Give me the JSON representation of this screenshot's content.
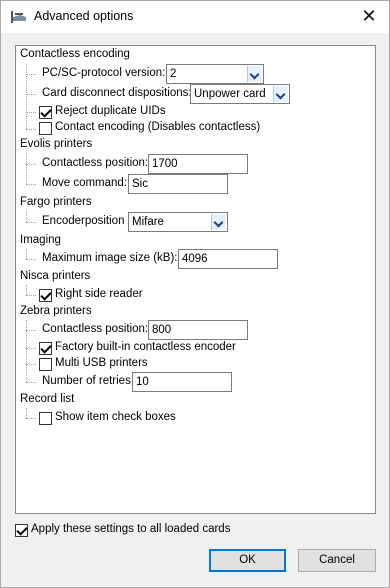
{
  "window": {
    "title": "Advanced options"
  },
  "sections": {
    "contactless": {
      "heading": "Contactless encoding",
      "pcsc_label": "PC/SC-protocol version:",
      "pcsc_value": "2",
      "disconnect_label": "Card disconnect dispositions:",
      "disconnect_value": "Unpower card",
      "reject_label": "Reject duplicate UIDs",
      "reject_checked": true,
      "contact_label": "Contact encoding (Disables contactless)",
      "contact_checked": false
    },
    "evolis": {
      "heading": "Evolis printers",
      "position_label": "Contactless position:",
      "position_value": "1700",
      "move_label": "Move command:",
      "move_value": "Sic"
    },
    "fargo": {
      "heading": "Fargo printers",
      "encoder_label": "Encoderposition",
      "encoder_value": "Mifare"
    },
    "imaging": {
      "heading": "Imaging",
      "max_label": "Maximum image size (kB):",
      "max_value": "4096"
    },
    "nisca": {
      "heading": "Nisca printers",
      "right_label": "Right side reader",
      "right_checked": true
    },
    "zebra": {
      "heading": "Zebra printers",
      "position_label": "Contactless position:",
      "position_value": "800",
      "factory_label": "Factory built-in contactless encoder",
      "factory_checked": true,
      "multi_label": "Multi USB printers",
      "multi_checked": false,
      "retries_label": "Number of retries",
      "retries_value": "10"
    },
    "record": {
      "heading": "Record list",
      "show_label": "Show item check boxes",
      "show_checked": false
    }
  },
  "footer": {
    "apply_label": "Apply these settings to all loaded cards",
    "apply_checked": true,
    "ok_label": "OK",
    "cancel_label": "Cancel"
  }
}
